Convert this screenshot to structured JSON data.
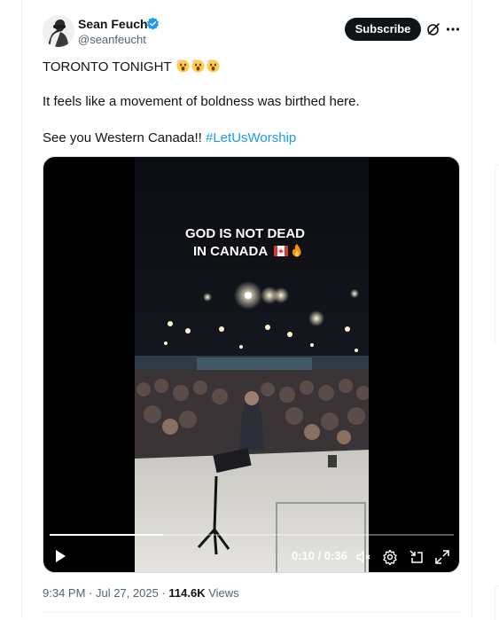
{
  "author": {
    "name": "Sean Feucht",
    "handle": "@seanfeucht",
    "verified": true,
    "verified_color": "#1d9bf0"
  },
  "actions": {
    "subscribe_label": "Subscribe",
    "grok_icon": "grok-icon",
    "more_icon": "more-icon"
  },
  "tweet": {
    "line1_text": "TORONTO TONIGHT",
    "line1_emojis": [
      "astonished-face",
      "astonished-face",
      "astonished-face"
    ],
    "line2_text": "It feels like a movement of boldness was birthed here.",
    "line3_text": "See you Western Canada!! ",
    "hashtag": "#LetUsWorship",
    "link_color": "#1d9bf0"
  },
  "video": {
    "overlay_line1": "GOD IS NOT DEAD",
    "overlay_line2": "IN CANADA",
    "overlay_emojis": [
      "canada-flag",
      "fire"
    ],
    "current_time": "0:10",
    "duration": "0:36",
    "time_separator": " / ",
    "progress": 0.28,
    "controls": [
      "play-icon",
      "mute-icon",
      "settings-icon",
      "minimize-icon",
      "fullscreen-icon"
    ]
  },
  "footer": {
    "time": "9:34 PM",
    "date": "Jul 27, 2025",
    "separator": " · ",
    "views_count": "114.6K",
    "views_label": " Views"
  }
}
